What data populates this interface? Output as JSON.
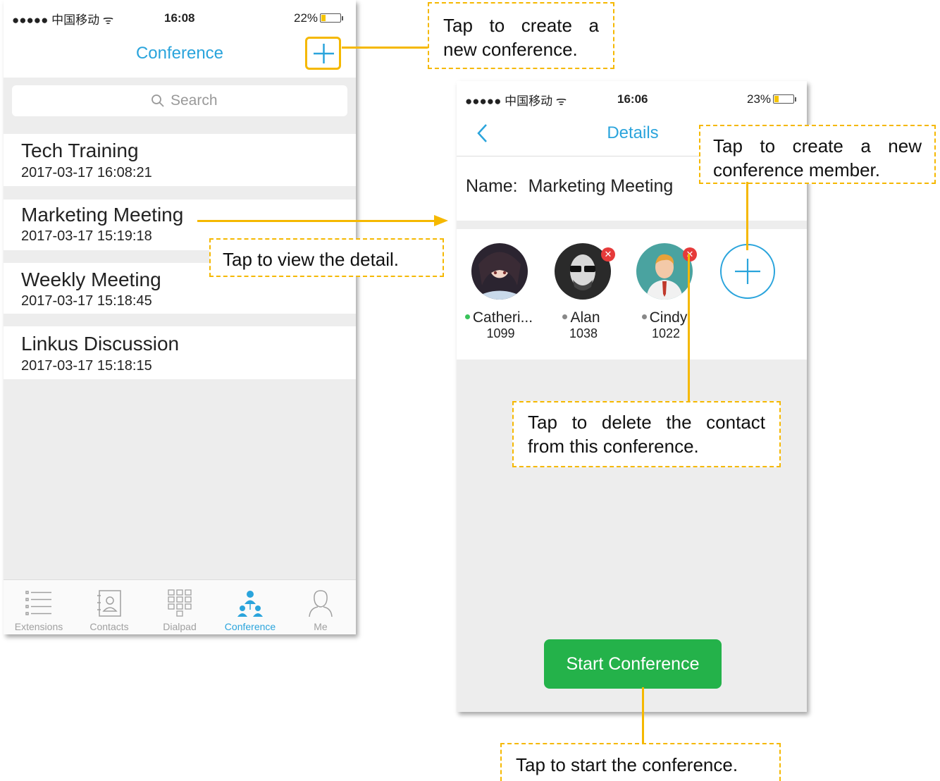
{
  "colors": {
    "accent": "#2aa4dc",
    "annotation": "#f5b800",
    "start_button": "#24b24a",
    "delete_badge": "#e63a3a",
    "online": "#39c35a",
    "offline": "#888888"
  },
  "screen1": {
    "status": {
      "carrier": "●●●●● 中国移动 ᯤ",
      "time": "16:08",
      "battery": "22%",
      "battery_level": 0.22
    },
    "title": "Conference",
    "add_icon": "plus-icon",
    "search_placeholder": "Search",
    "conferences": [
      {
        "name": "Tech Training",
        "date": "2017-03-17 16:08:21"
      },
      {
        "name": "Marketing Meeting",
        "date": "2017-03-17 15:19:18"
      },
      {
        "name": "Weekly Meeting",
        "date": "2017-03-17 15:18:45"
      },
      {
        "name": "Linkus Discussion",
        "date": "2017-03-17 15:18:15"
      }
    ],
    "tabs": [
      {
        "label": "Extensions",
        "icon": "list-icon"
      },
      {
        "label": "Contacts",
        "icon": "contacts-book-icon"
      },
      {
        "label": "Dialpad",
        "icon": "dialpad-icon"
      },
      {
        "label": "Conference",
        "icon": "conference-icon"
      },
      {
        "label": "Me",
        "icon": "person-icon"
      }
    ]
  },
  "screen2": {
    "status": {
      "carrier": "●●●●● 中国移动 ᯤ",
      "time": "16:06",
      "battery": "23%",
      "battery_level": 0.23
    },
    "back_icon": "chevron-left-icon",
    "title": "Details",
    "name_label": "Name:",
    "name_value": "Marketing Meeting",
    "members": [
      {
        "name": "Catheri...",
        "ext": "1099",
        "status": "online"
      },
      {
        "name": "Alan",
        "ext": "1038",
        "status": "offline"
      },
      {
        "name": "Cindy",
        "ext": "1022",
        "status": "offline"
      }
    ],
    "add_member_icon": "plus-circle-icon",
    "start_button": "Start Conference"
  },
  "annotations": {
    "create_conference": "Tap to create a new conference.",
    "view_detail": "Tap to view the detail.",
    "create_member": "Tap to create a new conference member.",
    "delete_contact": "Tap to delete the contact from this conference.",
    "start_conference": "Tap to start the conference."
  }
}
